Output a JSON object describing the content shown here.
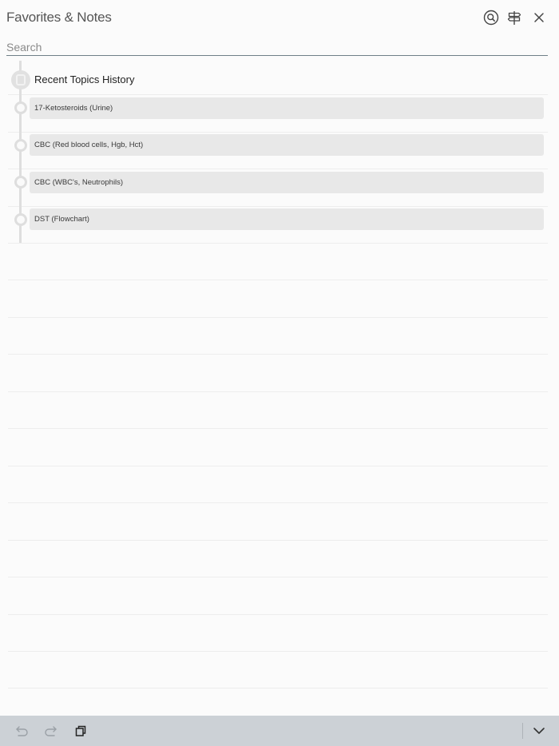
{
  "header": {
    "title": "Favorites & Notes",
    "icons": [
      "search-icon",
      "signpost-icon",
      "close-icon"
    ]
  },
  "search": {
    "placeholder": "Search",
    "value": ""
  },
  "section": {
    "title": "Recent Topics History"
  },
  "items": [
    {
      "label": "17-Ketosteroids (Urine)"
    },
    {
      "label": "CBC (Red blood cells, Hgb, Hct)"
    },
    {
      "label": "CBC (WBC's, Neutrophils)"
    },
    {
      "label": "DST (Flowchart)"
    }
  ],
  "footer": {
    "icons": [
      "undo-icon",
      "redo-icon",
      "copy-icon",
      "chevron-down-icon"
    ]
  },
  "colors": {
    "background": "#fbfbfb",
    "item_background": "#e8e8e8",
    "timeline": "#dedede",
    "footer_bar": "#ccd1d6",
    "search_underline": "#6f7f88"
  }
}
